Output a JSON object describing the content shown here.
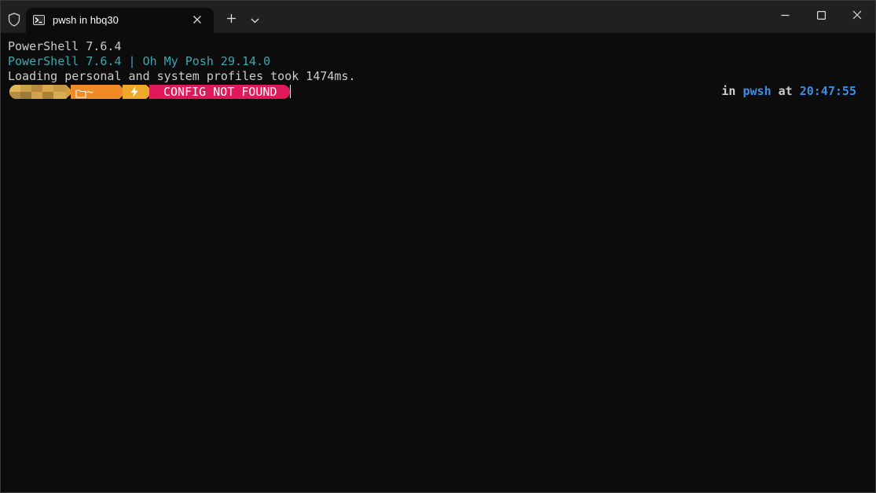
{
  "window": {
    "tab_title": "pwsh in hbq30"
  },
  "icons": {
    "shield": "shield-icon",
    "tab": "powershell-icon",
    "tab_close": "close-icon",
    "new_tab": "plus-icon",
    "dropdown": "chevron-down-icon",
    "minimize": "minimize-icon",
    "maximize": "maximize-icon",
    "close": "close-icon",
    "folder": "folder-icon",
    "power": "lightning-icon"
  },
  "terminal": {
    "line1": "PowerShell 7.6.4",
    "line2": "PowerShell 7.6.4 | Oh My Posh 29.14.0",
    "line3": "Loading personal and system profiles took 1474ms."
  },
  "prompt": {
    "path": "~",
    "error": "CONFIG NOT FOUND"
  },
  "right_prompt": {
    "in_label": "in",
    "shell": "pwsh",
    "at_label": "at",
    "time": "20:47:55"
  },
  "colors": {
    "background": "#0c0c0c",
    "titlebar": "#202020",
    "user_segment": "#d3a040",
    "path_segment": "#f08a24",
    "power_segment": "#f0a82a",
    "error_segment": "#e0195a",
    "accent_blue": "#3b8eea",
    "teal": "#3aa8b0"
  }
}
